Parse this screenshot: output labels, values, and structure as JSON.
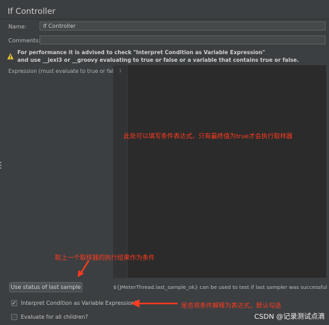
{
  "panel": {
    "title": "If Controller"
  },
  "form": {
    "name_label": "Name:",
    "name_value": "If Controller",
    "comments_label": "Comments:",
    "comments_value": ""
  },
  "warning": {
    "icon": "warning-icon",
    "line1": "For performance it is advised to check \"Interpret Condition as Variable Expression\"",
    "line2": "and use __jexl3 or __groovy evaluating to true or false or a variable that contains true or false."
  },
  "expression": {
    "label": "Expression (must evaluate to true or false)",
    "line_number": "1",
    "content": ""
  },
  "annotations": {
    "editor_note": "此处可以填写条件表达式，只有最终值为true才会执行取样器",
    "button_note": "取上一个取样器的执行结果作为条件",
    "checkbox_note": "是否将条件解释为表达式，默认勾选",
    "color": "#ff3b1f"
  },
  "last_sample": {
    "button_label": "Use status of last sample",
    "hint": "${JMeterThread.last_sample_ok} can be used to test if last sampler was successful"
  },
  "options": {
    "interpret_label": "Interpret Condition as Variable Expression?",
    "interpret_checked": true,
    "evaluate_all_label": "Evaluate for all children?",
    "evaluate_all_checked": false,
    "check_glyph": "✓"
  },
  "watermark": {
    "text": "CSDN @记录测试点滴"
  },
  "colors": {
    "background": "#3c3f41",
    "editor_background": "#2b2b2b",
    "warning_yellow": "#f0c330"
  }
}
